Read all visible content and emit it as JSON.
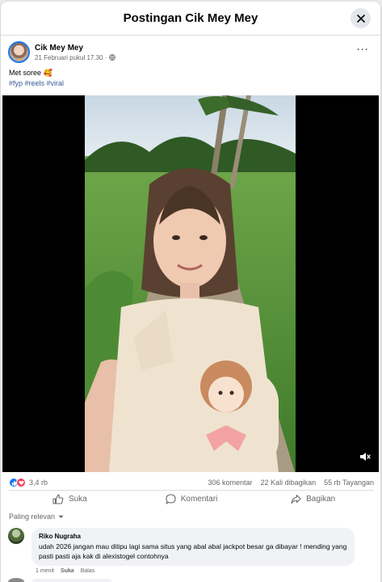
{
  "header": {
    "title": "Postingan Cik Mey Mey"
  },
  "post": {
    "author_name": "Cik Mey Mey",
    "timestamp": "21 Februari pukul 17.30 ·",
    "caption": "Met soree 🥰",
    "hashtags": "#fyp #reels #viral"
  },
  "stats": {
    "reactions": "3,4 rb",
    "comments": "306 komentar",
    "shares": "22 Kali dibagikan",
    "views": "55 rb Tayangan"
  },
  "actions": {
    "like": "Suka",
    "comment": "Komentari",
    "share": "Bagikan"
  },
  "comments_section": {
    "sort_label": "Paling relevan",
    "items": [
      {
        "author": "Riko Nugraha",
        "text": "udah 2026 jangan mau ditipu lagi sama situs yang abal abal jackpot besar ga dibayar ! mending yang pasti pasti aja kak di alexistogel contohnya",
        "time": "1 menit",
        "like": "Suka",
        "reply": "Balas"
      }
    ]
  },
  "icons": [
    "close-icon",
    "globe-icon",
    "more-icon",
    "like-reaction-icon",
    "love-reaction-icon",
    "like-icon",
    "comment-icon",
    "share-icon",
    "volume-mute-icon",
    "chevron-down-icon"
  ]
}
